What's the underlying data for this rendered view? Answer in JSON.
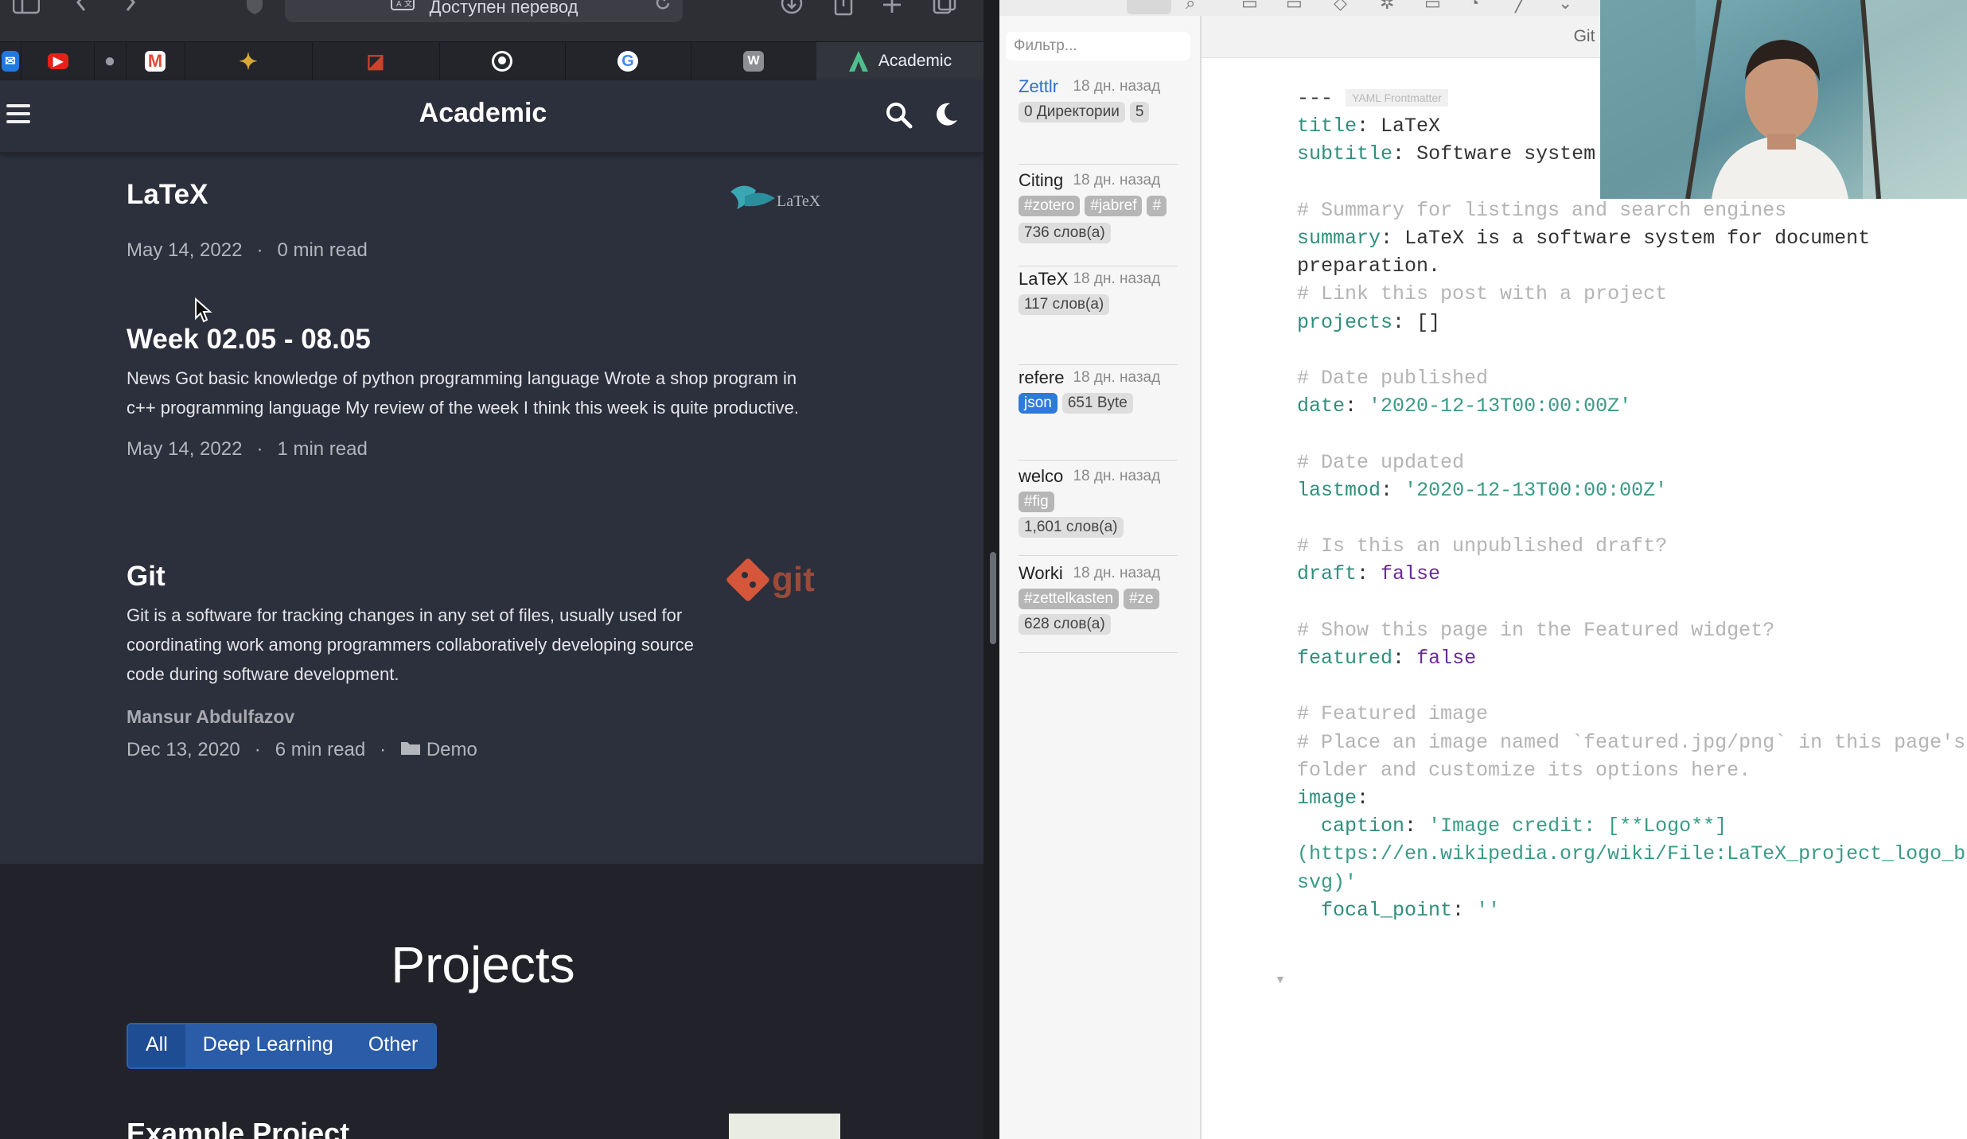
{
  "browser": {
    "address_bar_text": "Доступен перевод",
    "tabs": [
      {
        "icon": "mail-icon",
        "color": "#1f7ae0"
      },
      {
        "icon": "youtube-icon",
        "color": "#e62117"
      },
      {
        "icon": "apple-icon",
        "color": "#9a9ba2"
      },
      {
        "icon": "gmail-icon",
        "color": "#e5483b"
      },
      {
        "icon": "star-icon",
        "color": "#d8a838"
      },
      {
        "icon": "bookmark-icon",
        "color": "#c8442b"
      },
      {
        "icon": "github-icon",
        "color": "#ffffff"
      },
      {
        "icon": "google-icon",
        "color": "#4285f4"
      },
      {
        "icon": "w-icon",
        "color": "#8d8e94",
        "letter": "W"
      }
    ],
    "active_tab": {
      "label": "Academic",
      "icon": "academic-icon"
    }
  },
  "site": {
    "title": "Academic",
    "posts": [
      {
        "title": "LaTeX",
        "summary": "",
        "author": "",
        "date": "May 14, 2022",
        "read_time": "0 min read",
        "category": ""
      },
      {
        "title": "Week 02.05 - 08.05",
        "summary": "News Got basic knowledge of python programming language Wrote a shop program in c++ programming language My review of the week I think this week is quite productive.",
        "author": "",
        "date": "May 14, 2022",
        "read_time": "1 min read",
        "category": ""
      },
      {
        "title": "Git",
        "summary": "Git is a software for tracking changes in any set of files, usually used for coordinating work among programmers collaboratively developing source code during software development.",
        "author": "Mansur Abdulfazov",
        "date": "Dec 13, 2020",
        "read_time": "6 min read",
        "category": "Demo"
      }
    ],
    "dot": "·",
    "latex_logo_text": "LaTeX",
    "git_logo_text": "git",
    "projects": {
      "title": "Projects",
      "filters": [
        "All",
        "Deep Learning",
        "Other"
      ],
      "active_filter": "All",
      "peek_title": "Example Project"
    }
  },
  "editor": {
    "filter_placeholder": "Фильтр...",
    "doc_tab": "Git",
    "files": [
      {
        "name": "Zettlr",
        "time": "18 дн. назад",
        "tags": [
          {
            "text": "0 Директории",
            "kind": "plain"
          },
          {
            "text": "5",
            "kind": "plain"
          }
        ],
        "active": true
      },
      {
        "name": "Citing",
        "time": "18 дн. назад",
        "tags": [
          {
            "text": "#zotero",
            "kind": "gray"
          },
          {
            "text": "#jabref",
            "kind": "gray"
          },
          {
            "text": "#",
            "kind": "gray"
          }
        ],
        "words": "736 слов(а)",
        "active": false
      },
      {
        "name": "LaTeX",
        "time": "18 дн. назад",
        "tags": [
          {
            "text": "117 слов(а)",
            "kind": "plain"
          }
        ],
        "active": false
      },
      {
        "name": "refere",
        "time": "18 дн. назад",
        "tags": [
          {
            "text": "json",
            "kind": "blue"
          },
          {
            "text": "651 Byte",
            "kind": "plain"
          }
        ],
        "active": false
      },
      {
        "name": "welco",
        "time": "18 дн. назад",
        "tags": [
          {
            "text": "#fig",
            "kind": "gray"
          }
        ],
        "words": "1,601 слов(а)",
        "active": false
      },
      {
        "name": "Worki",
        "time": "18 дн. назад",
        "tags": [
          {
            "text": "#zettelkasten",
            "kind": "gray"
          },
          {
            "text": "#ze",
            "kind": "gray"
          }
        ],
        "words": "628 слов(а)",
        "active": false
      }
    ],
    "yaml_badge": "YAML Frontmatter",
    "lines": [
      {
        "type": "sep",
        "text": "---"
      },
      {
        "type": "kv",
        "key": "title",
        "value": "LaTeX",
        "vclass": "p"
      },
      {
        "type": "kv",
        "key": "subtitle",
        "value": "Software system for document preparation",
        "vclass": "p"
      },
      {
        "type": "blank"
      },
      {
        "type": "comment",
        "text": "# Summary for listings and search engines"
      },
      {
        "type": "kv",
        "key": "summary",
        "value": "LaTeX  is a software system for document",
        "vclass": "p"
      },
      {
        "type": "plain",
        "text": "preparation."
      },
      {
        "type": "comment",
        "text": "# Link this post with a project"
      },
      {
        "type": "kv",
        "key": "projects",
        "value": "[]",
        "vclass": "p"
      },
      {
        "type": "blank"
      },
      {
        "type": "comment",
        "text": "# Date published"
      },
      {
        "type": "kv",
        "key": "date",
        "value": "'2020-12-13T00:00:00Z'",
        "vclass": "s"
      },
      {
        "type": "blank"
      },
      {
        "type": "comment",
        "text": "# Date updated"
      },
      {
        "type": "kv",
        "key": "lastmod",
        "value": "'2020-12-13T00:00:00Z'",
        "vclass": "s"
      },
      {
        "type": "blank"
      },
      {
        "type": "comment",
        "text": "# Is this an unpublished draft?"
      },
      {
        "type": "kv",
        "key": "draft",
        "value": "false",
        "vclass": "b"
      },
      {
        "type": "blank"
      },
      {
        "type": "comment",
        "text": "# Show this page in the Featured widget?"
      },
      {
        "type": "kv",
        "key": "featured",
        "value": "false",
        "vclass": "b"
      },
      {
        "type": "blank"
      },
      {
        "type": "comment",
        "text": "# Featured image"
      },
      {
        "type": "comment",
        "text": "# Place an image named `featured.jpg/png` in this page's"
      },
      {
        "type": "comment",
        "text": "folder and customize its options here."
      },
      {
        "type": "kv",
        "key": "image",
        "value": "",
        "vclass": "p"
      },
      {
        "type": "kv",
        "key": "  caption",
        "value": "'Image credit: [**Logo**]",
        "vclass": "s"
      },
      {
        "type": "string",
        "text": "(https://en.wikipedia.org/wiki/File:LaTeX_project_logo_bird."
      },
      {
        "type": "string",
        "text": "svg)'"
      },
      {
        "type": "kv",
        "key": "  focal_point",
        "value": "''",
        "vclass": "s"
      }
    ]
  }
}
